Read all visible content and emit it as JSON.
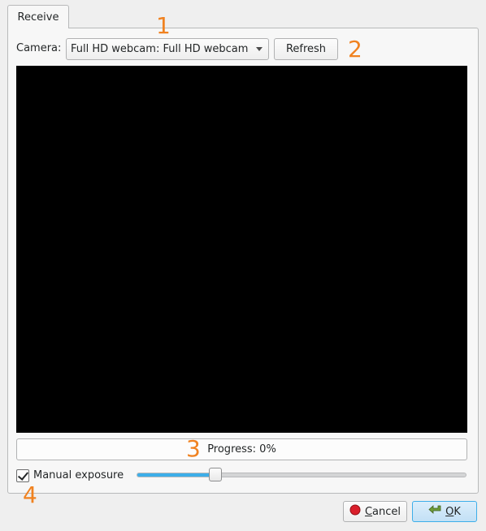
{
  "tabs": [
    {
      "label": "Receive"
    }
  ],
  "camera": {
    "label": "Camera:",
    "selected": "Full HD webcam: Full HD webcam"
  },
  "refresh_label": "Refresh",
  "progress": {
    "text": "Progress: 0%",
    "value": 0
  },
  "exposure": {
    "label": "Manual exposure",
    "checked": true,
    "slider_value": 0.24
  },
  "buttons": {
    "cancel_prefix": "",
    "cancel_underlined": "C",
    "cancel_rest": "ancel",
    "ok_underlined": "O",
    "ok_rest": "K"
  },
  "callouts": [
    "1",
    "2",
    "3",
    "4"
  ],
  "colors": {
    "accent": "#3daee9",
    "callout": "#f08220",
    "video_background": "#000000"
  },
  "icons": {
    "cancel": "red-circle-icon",
    "ok": "green-arrow-icon"
  }
}
